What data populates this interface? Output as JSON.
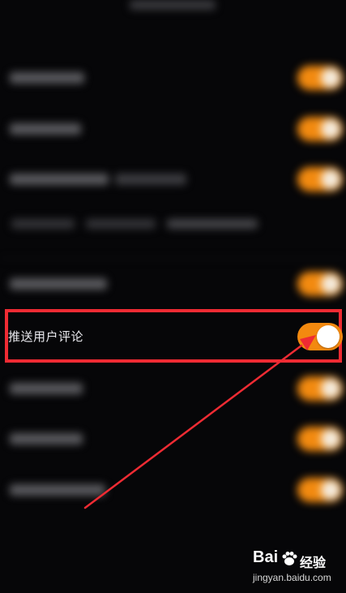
{
  "focus_row": {
    "label": "推送用户评论",
    "toggle_on": true
  },
  "watermark": {
    "logo": "Bai",
    "logo_suffix": "经验",
    "url": "jingyan.baidu.com"
  },
  "colors": {
    "accent": "#f3890f",
    "highlight": "#ef2b33",
    "background": "#060608"
  },
  "icons": {
    "annotation": "arrow-icon",
    "watermark": "paw-icon"
  }
}
